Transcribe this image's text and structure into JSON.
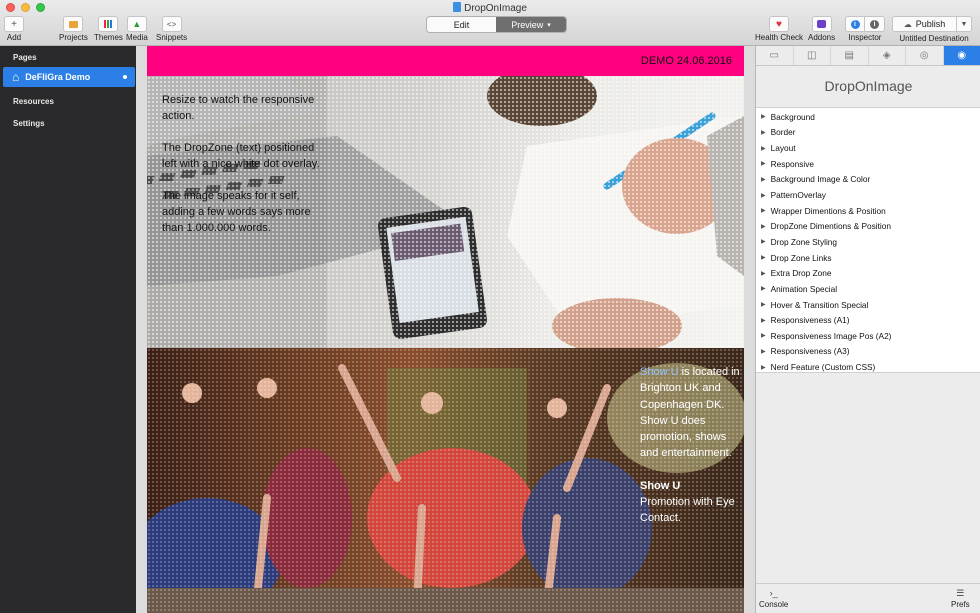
{
  "window": {
    "title": "DropOnImage"
  },
  "toolbar": {
    "left_buttons": [
      {
        "label": "Add",
        "icon": "plus-icon"
      },
      {
        "label": "Projects",
        "icon": "projects-icon"
      },
      {
        "label": "Themes",
        "icon": "themes-icon"
      },
      {
        "label": "Media",
        "icon": "media-icon"
      },
      {
        "label": "Snippets",
        "icon": "snippets-icon"
      }
    ],
    "mode": {
      "edit_label": "Edit",
      "preview_label": "Preview"
    },
    "right_buttons": [
      {
        "label": "Health Check",
        "icon": "heart-icon"
      },
      {
        "label": "Addons",
        "icon": "addons-icon"
      },
      {
        "label": "Inspector",
        "icon": "info-icon"
      }
    ],
    "publish_label": "Publish",
    "destination_label": "Untitled Destination"
  },
  "sidebar": {
    "pages_header": "Pages",
    "selected_page": "DeFliGra Demo",
    "resources_header": "Resources",
    "settings_header": "Settings"
  },
  "preview": {
    "banner_text": "DEMO 24.06.2016",
    "hero_paragraphs": [
      "Resize to watch the responsive action.",
      "The DropZone (text) positioned left with a nice white dot overlay.",
      "The image speaks for it self, adding a few words says more than 1.000.000 words."
    ],
    "show": {
      "p1_highlight": "Show U",
      "p1_rest": " is located in Brighton UK and Copenhagen DK. Show U does promotion, shows and entertainment.",
      "p2_bold": "Show U",
      "p2_rest": "Promotion with Eye Contact."
    }
  },
  "inspector": {
    "title": "DropOnImage",
    "sections": [
      "Background",
      "Border",
      "Layout",
      "Responsive",
      "Background Image & Color",
      "PatternOverlay",
      "Wrapper Dimentions & Position",
      "DropZone Dimentions & Position",
      "Drop Zone Styling",
      "Drop Zone Links",
      "Extra Drop Zone",
      "Animation Special",
      "Hover & Transition Special",
      "Responsiveness (A1)",
      "Responsiveness Image Pos (A2)",
      "Responsiveness (A3)",
      "Nerd Feature (Custom CSS)"
    ],
    "console_label": "Console",
    "prefs_label": "Prefs"
  },
  "colors": {
    "banner": "#ff0080",
    "selection": "#2b7fe6",
    "sidebar_bg": "#2a2a2c"
  }
}
